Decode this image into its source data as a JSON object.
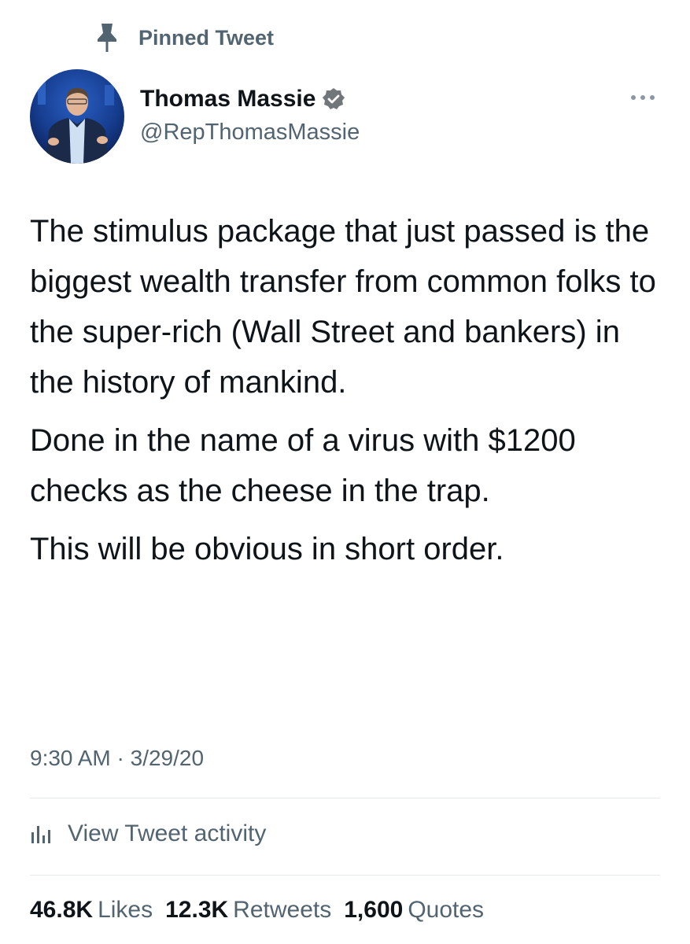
{
  "pinned": {
    "label": "Pinned Tweet",
    "icon": "pin-icon"
  },
  "author": {
    "name": "Thomas Massie",
    "handle": "@RepThomasMassie",
    "verified": true,
    "verified_color": "#71767b"
  },
  "tweet": {
    "paragraphs": [
      "The stimulus package that just passed is the biggest wealth transfer from common folks to the super-rich (Wall Street and bankers) in the history of mankind.",
      "Done in the name of a virus with $1200 checks as the cheese in the trap.",
      "This will be obvious in short order."
    ],
    "time": "9:30 AM",
    "separator": "·",
    "date": "3/29/20"
  },
  "activity": {
    "label": "View Tweet activity",
    "icon": "analytics-icon"
  },
  "stats": {
    "likes_value": "46.8K",
    "likes_label": "Likes",
    "retweets_value": "12.3K",
    "retweets_label": "Retweets",
    "quotes_value": "1,600",
    "quotes_label": "Quotes"
  },
  "colors": {
    "text": "#0f1419",
    "secondary": "#536471",
    "divider": "#e6e9ec",
    "background": "#ffffff"
  }
}
